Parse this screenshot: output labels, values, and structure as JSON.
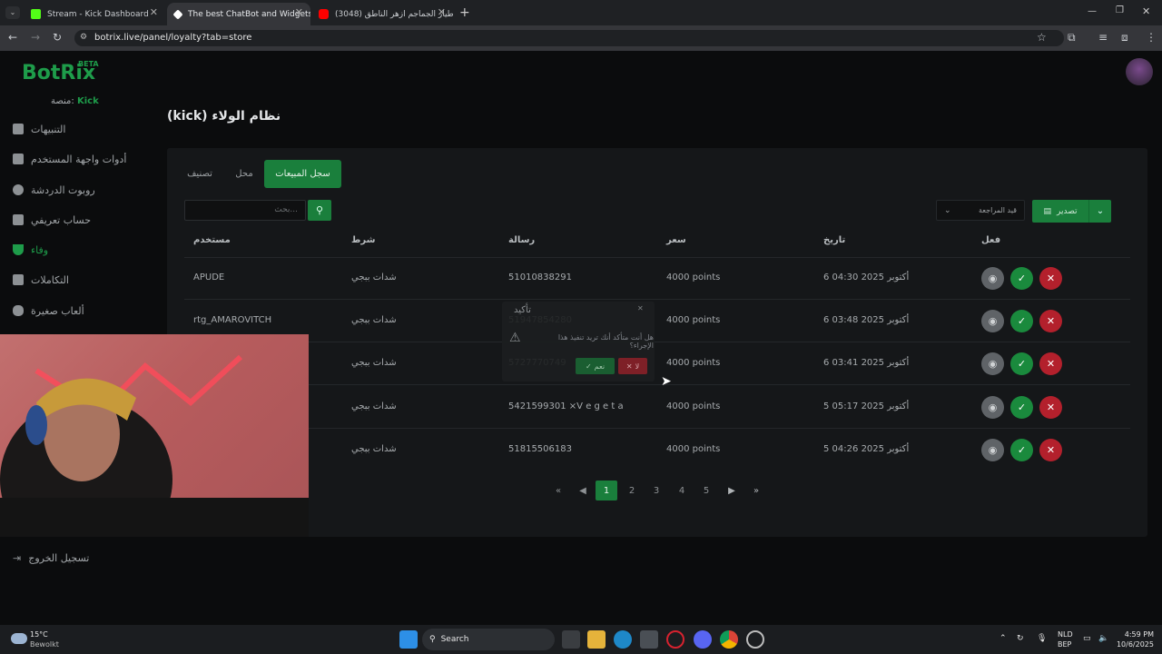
{
  "browser": {
    "tabs": [
      {
        "title": "Stream - Kick Dashboard",
        "favicon_color": "#53fc18"
      },
      {
        "title": "The best ChatBot and Widgets",
        "favicon_color": "#ffffff"
      },
      {
        "title": "(3048) طيار الجماجم ازهر الناطق",
        "favicon_color": "#ff0000"
      }
    ],
    "url": "botrix.live/panel/loyalty?tab=store"
  },
  "sidebar": {
    "logo": "BotRix",
    "beta": "BETA",
    "platform_label": "منصة:",
    "platform_value": "Kick",
    "items": [
      {
        "label": "التنبيهات",
        "icon": "warning-icon"
      },
      {
        "label": "أدوات واجهة المستخدم",
        "icon": "widgets-icon"
      },
      {
        "label": "روبوت الدردشة",
        "icon": "robot-icon"
      },
      {
        "label": "حساب تعريفي",
        "icon": "profile-card-icon"
      },
      {
        "label": "وفاء",
        "icon": "trophy-icon"
      },
      {
        "label": "التكاملات",
        "icon": "integrations-icon"
      },
      {
        "label": "ألعاب صغيرة",
        "icon": "gamepad-icon"
      }
    ],
    "logout": "تسجيل الخروج"
  },
  "main": {
    "title": "نظام الولاء (kick)",
    "tabs": [
      "تصنيف",
      "محل",
      "سجل المبيعات"
    ],
    "search_placeholder": "...بحث",
    "filter_label": "قيد المراجعة",
    "export_label": "تصدير",
    "columns": [
      "مستخدم",
      "شرط",
      "رسالة",
      "سعر",
      "تاريخ",
      "فعل"
    ],
    "rows": [
      {
        "user": "APUDE",
        "item": "شدات ببجي",
        "message": "51010838291",
        "price": "4000 points",
        "date": "6 أكتوبر 2025 04:30"
      },
      {
        "user": "rtg_AMAROVITCH",
        "item": "شدات ببجي",
        "message": "51947854280",
        "price": "4000 points",
        "date": "6 أكتوبر 2025 03:48"
      },
      {
        "user": "",
        "item": "شدات ببجي",
        "message": "5727770749",
        "price": "4000 points",
        "date": "6 أكتوبر 2025 03:41"
      },
      {
        "user": "",
        "item": "شدات ببجي",
        "message": "5421599301 ×V e g e t a",
        "price": "4000 points",
        "date": "5 أكتوبر 2025 05:17"
      },
      {
        "user": "",
        "item": "شدات ببجي",
        "message": "51815506183",
        "price": "4000 points",
        "date": "5 أكتوبر 2025 04:26"
      }
    ],
    "confirm": {
      "title": "تأكيد",
      "text": "هل أنت متأكد أنك تريد تنفيذ هذا الإجراء؟",
      "yes": "نعم",
      "no": "لا"
    },
    "pagination": {
      "pages": [
        "1",
        "2",
        "3",
        "4",
        "5"
      ],
      "current": "1"
    }
  },
  "taskbar": {
    "weather_temp": "15°C",
    "weather_desc": "Bewolkt",
    "search": "Search",
    "lang": "NLD",
    "lang2": "BEP",
    "time": "4:59 PM",
    "date": "10/6/2025"
  },
  "colors": {
    "accent": "#1a7f3c",
    "danger": "#b3202c",
    "brand_green": "#1e9c4a"
  }
}
